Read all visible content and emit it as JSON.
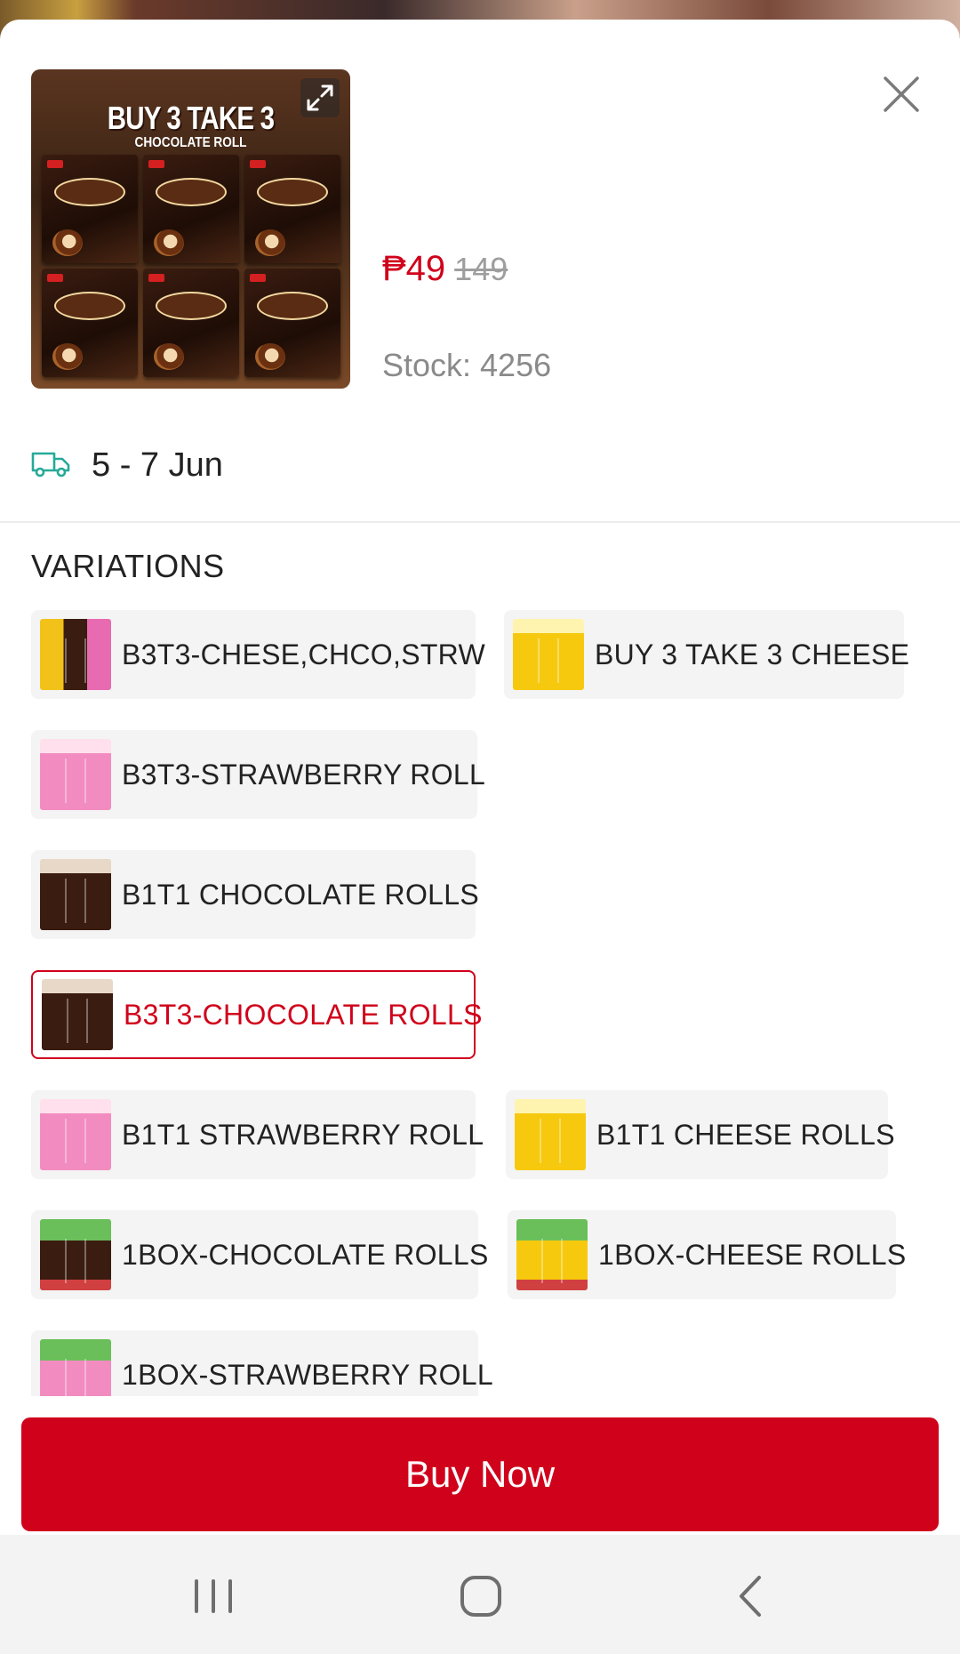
{
  "product": {
    "thumb_title": "BUY 3 TAKE 3",
    "thumb_subtitle": "CHOCOLATE ROLL",
    "price_current": "₱49",
    "price_original": "149",
    "stock": "Stock: 4256"
  },
  "delivery": {
    "icon": "truck-icon",
    "date_range": "5 - 7 Jun"
  },
  "variations": {
    "title": "VARIATIONS",
    "items": [
      {
        "label": "B3T3-CHESE,CHCO,STRW",
        "selected": false
      },
      {
        "label": "BUY 3 TAKE 3 CHEESE",
        "selected": false
      },
      {
        "label": "B3T3-STRAWBERRY ROLL",
        "selected": false
      },
      {
        "label": "B1T1 CHOCOLATE ROLLS",
        "selected": false
      },
      {
        "label": "B3T3-CHOCOLATE ROLLS",
        "selected": true
      },
      {
        "label": "B1T1 STRAWBERRY ROLL",
        "selected": false
      },
      {
        "label": "B1T1 CHEESE ROLLS",
        "selected": false
      },
      {
        "label": "1BOX-CHOCOLATE ROLLS",
        "selected": false
      },
      {
        "label": "1BOX-CHEESE ROLLS",
        "selected": false
      },
      {
        "label": "1BOX-STRAWBERRY ROLL",
        "selected": false
      }
    ]
  },
  "actions": {
    "buy_now_label": "Buy Now"
  },
  "colors": {
    "accent": "#d0011b",
    "delivery_icon": "#26aa99",
    "muted_text": "#8a8a8a"
  },
  "system_nav": {
    "recents": "recents-icon",
    "home": "home-icon",
    "back": "back-icon"
  }
}
